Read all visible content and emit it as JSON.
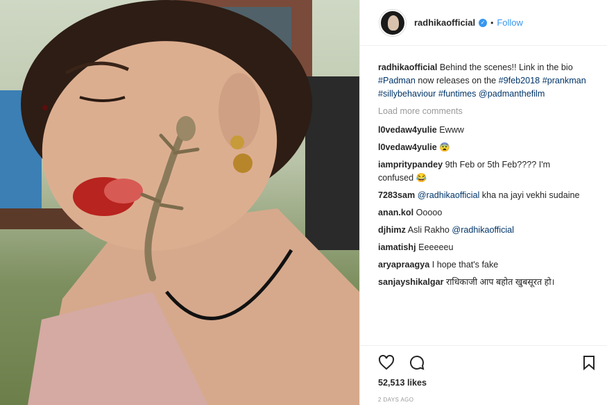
{
  "header": {
    "username": "radhikaofficial",
    "separator": "•",
    "follow_label": "Follow"
  },
  "caption": {
    "username": "radhikaofficial",
    "text_1": "Behind the scenes!! Link in the bio",
    "tag_1": "#Padman",
    "text_2": "now releases on the",
    "tag_2": "#9feb2018",
    "tag_3": "#prankman",
    "tag_4": "#sillybehaviour",
    "tag_5": "#funtimes",
    "tag_6": "@padmanthefilm"
  },
  "load_more_label": "Load more comments",
  "comments": [
    {
      "user": "l0vedaw4yulie",
      "text": "Ewww"
    },
    {
      "user": "l0vedaw4yulie",
      "text": "😨"
    },
    {
      "user": "iampritypandey",
      "text": "9th Feb or 5th Feb???? I'm confused 😂"
    },
    {
      "user": "7283sam",
      "mention": "@radhikaofficial",
      "text": "kha na jayi vekhi sudaine"
    },
    {
      "user": "anan.kol",
      "text": "Ooooo"
    },
    {
      "user": "djhimz",
      "text": "Asli Rakho",
      "mention": "@radhikaofficial"
    },
    {
      "user": "iamatishj",
      "text": "Eeeeeeu"
    },
    {
      "user": "aryapraagya",
      "text": "I hope that's fake"
    },
    {
      "user": "sanjayshikalgar",
      "text": "राधिकाजी आप बहोत खुबसूरत हो।"
    }
  ],
  "actions": {
    "likes": "52,513 likes",
    "date": "2 DAYS AGO"
  },
  "icons": {
    "like": "heart-icon",
    "comment": "comment-icon",
    "save": "bookmark-icon",
    "verified": "verified-badge-icon"
  },
  "colors": {
    "link_blue": "#3897f0",
    "hashtag": "#003569",
    "muted": "#999999"
  }
}
